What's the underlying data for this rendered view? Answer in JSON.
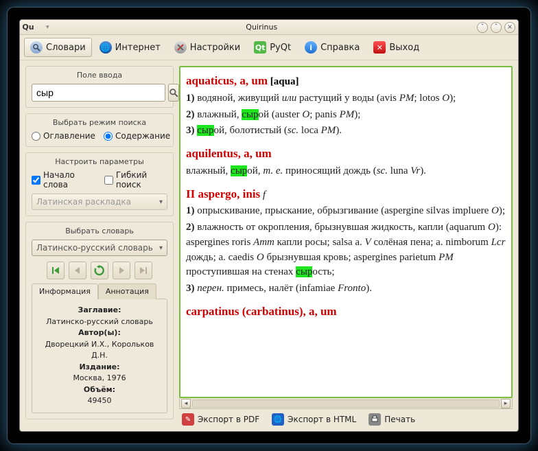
{
  "window": {
    "title": "Quirinus"
  },
  "toolbar": {
    "dictionaries": "Словари",
    "internet": "Интернет",
    "settings": "Настройки",
    "pyqt": "PyQt",
    "help": "Справка",
    "exit": "Выход"
  },
  "sidebar": {
    "search_title": "Поле ввода",
    "search_value": "сыр",
    "mode_title": "Выбрать режим поиска",
    "mode_toc": "Оглавление",
    "mode_content": "Содержание",
    "params_title": "Настроить параметры",
    "wordstart": "Начало слова",
    "fuzzy": "Гибкий поиск",
    "layout": "Латинская раскладка",
    "dict_title": "Выбрать словарь",
    "dict_selected": "Латинско-русский словарь",
    "tab_info": "Информация",
    "tab_anno": "Аннотация"
  },
  "info": {
    "t1": "Заглавие:",
    "v1": "Латинско-русский словарь",
    "t2": "Автор(ы):",
    "v2": "Дворецкий И.Х., Корольков Д.Н.",
    "t3": "Издание:",
    "v3": "Москва, 1976",
    "t4": "Объём:",
    "v4": "49450"
  },
  "entries": [
    {
      "head": "aquaticus, a, um",
      "etym": "aqua"
    },
    {
      "head": "aquilentus, a, um"
    },
    {
      "head": "II aspergo, inis"
    },
    {
      "head": "carpatinus (carbatinus), a, um"
    }
  ],
  "export": {
    "pdf": "Экспорт в PDF",
    "html": "Экспорт в HTML",
    "print": "Печать"
  }
}
